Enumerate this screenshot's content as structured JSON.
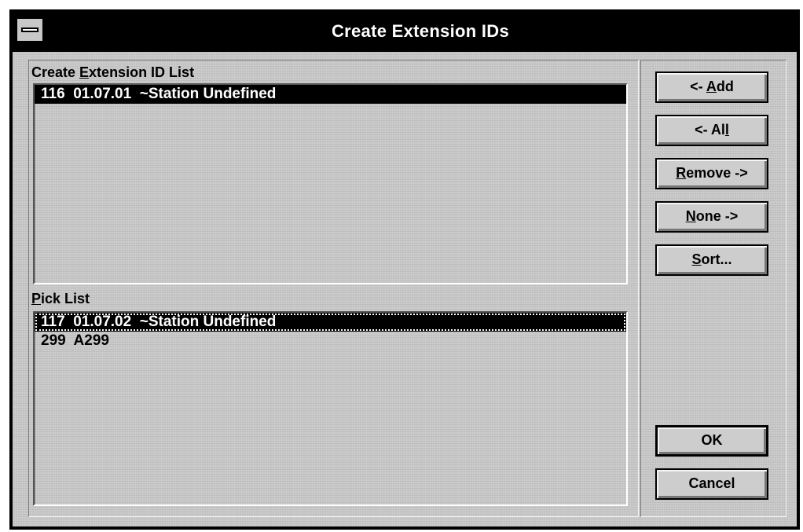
{
  "window": {
    "title": "Create Extension IDs"
  },
  "create_list": {
    "label_pre": "Create ",
    "label_mnemonic": "E",
    "label_post": "xtension ID List",
    "items": [
      {
        "text": "116  01.07.01  ~Station Undefined",
        "selected": true
      }
    ]
  },
  "pick_list": {
    "label_mnemonic": "P",
    "label_post": "ick List",
    "items": [
      {
        "text": "117  01.07.02  ~Station Undefined",
        "selected": true
      },
      {
        "text": "299  A299",
        "selected": false
      }
    ]
  },
  "buttons": {
    "add": {
      "pre": "<- ",
      "mnemonic": "A",
      "post": "dd"
    },
    "all": {
      "pre": "<- Al",
      "mnemonic": "l",
      "post": ""
    },
    "remove": {
      "pre": "",
      "mnemonic": "R",
      "post": "emove ->"
    },
    "none": {
      "pre": "",
      "mnemonic": "N",
      "post": "one ->"
    },
    "sort": {
      "pre": "",
      "mnemonic": "S",
      "post": "ort..."
    },
    "ok": {
      "label": "OK"
    },
    "cancel": {
      "label": "Cancel"
    }
  }
}
